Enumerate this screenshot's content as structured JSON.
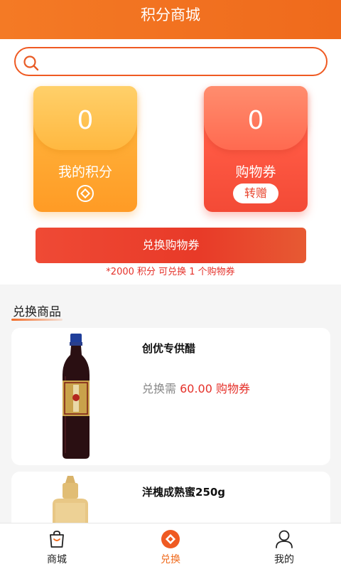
{
  "header": {
    "title": "积分商城"
  },
  "search": {
    "placeholder": ""
  },
  "points_card": {
    "value": "0",
    "label": "我的积分",
    "icon": "coin-icon"
  },
  "coupon_card": {
    "value": "0",
    "label": "购物券",
    "gift_label": "转赠"
  },
  "exchange": {
    "button_label": "兑换购物券",
    "note": "*2000 积分 可兑换 1 个购物券"
  },
  "section": {
    "title": "兑换商品"
  },
  "products": [
    {
      "name": "创优专供醋",
      "price_prefix": "兑换需",
      "price_value": "60.00 购物券",
      "image": "vinegar-bottle"
    },
    {
      "name": "洋槐成熟蜜250g",
      "image": "honey-bottle"
    }
  ],
  "tabbar": {
    "items": [
      {
        "label": "商城",
        "icon": "shopping-bag-icon"
      },
      {
        "label": "兑换",
        "icon": "exchange-icon",
        "active": true
      },
      {
        "label": "我的",
        "icon": "user-icon"
      }
    ]
  },
  "colors": {
    "accent": "#ef6a1c",
    "brand_red": "#e5312a",
    "points_orange": "#ffad36",
    "coupon_red": "#ff5a44"
  }
}
